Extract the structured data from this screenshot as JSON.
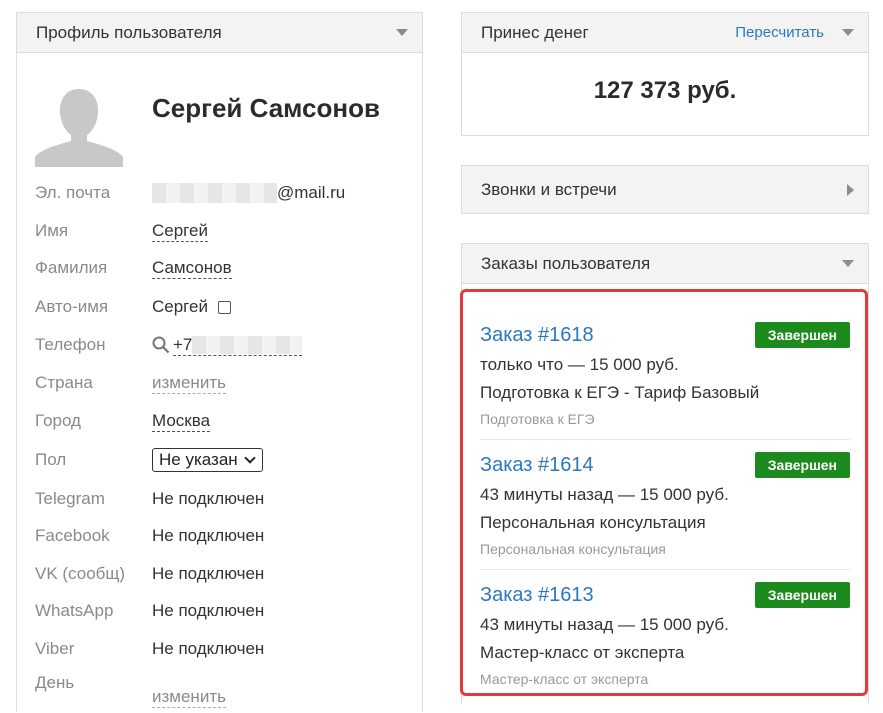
{
  "profile": {
    "header": "Профиль пользователя",
    "name": "Сергей Самсонов",
    "fields": {
      "email_label": "Эл. почта",
      "email_suffix": "@mail.ru",
      "first_name_label": "Имя",
      "first_name": "Сергей",
      "last_name_label": "Фамилия",
      "last_name": "Самсонов",
      "auto_name_label": "Авто-имя",
      "auto_name": "Сергей",
      "phone_label": "Телефон",
      "phone_prefix": "+7",
      "country_label": "Страна",
      "country_action": "изменить",
      "city_label": "Город",
      "city": "Москва",
      "gender_label": "Пол",
      "gender_selected": "Не указан",
      "telegram_label": "Telegram",
      "telegram": "Не подключен",
      "facebook_label": "Facebook",
      "facebook": "Не подключен",
      "vk_label": "VK (сообщ)",
      "vk": "Не подключен",
      "whatsapp_label": "WhatsApp",
      "whatsapp": "Не подключен",
      "viber_label": "Viber",
      "viber": "Не подключен",
      "birthday_label": "День",
      "birthday_action": "изменить"
    }
  },
  "money": {
    "header": "Принес денег",
    "recalc": "Пересчитать",
    "value": "127 373 руб."
  },
  "calls": {
    "header": "Звонки и встречи"
  },
  "orders": {
    "header": "Заказы пользователя",
    "items": [
      {
        "title": "Заказ #1618",
        "status": "Завершен",
        "meta": "только что — 15 000 руб.",
        "product": "Подготовка к ЕГЭ - Тариф Базовый",
        "group": "Подготовка к ЕГЭ"
      },
      {
        "title": "Заказ #1614",
        "status": "Завершен",
        "meta": "43 минуты назад — 15 000 руб.",
        "product": "Персональная консультация",
        "group": "Персональная консультация"
      },
      {
        "title": "Заказ #1613",
        "status": "Завершен",
        "meta": "43 минуты назад — 15 000 руб.",
        "product": "Мастер-класс от эксперта",
        "group": "Мастер-класс от эксперта"
      }
    ]
  },
  "colors": {
    "link": "#2a78c2",
    "status_done": "#1c8a1c",
    "highlight": "#e03b3b"
  },
  "icons": [
    "chevron-down-icon",
    "chevron-right-icon",
    "search-icon",
    "avatar-placeholder-icon"
  ]
}
